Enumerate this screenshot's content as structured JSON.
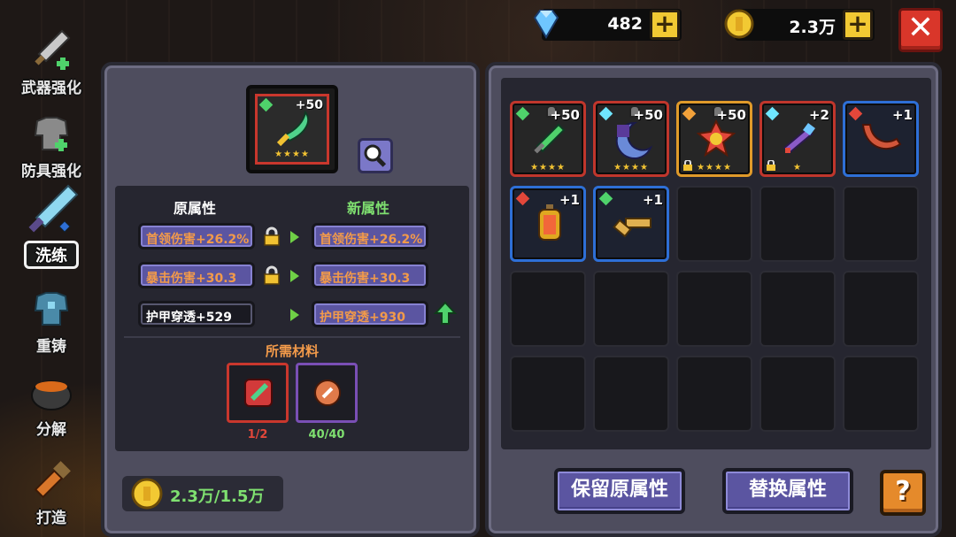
{
  "sidebar": {
    "items": [
      {
        "label": "武器强化",
        "icon": "sword-upgrade-icon"
      },
      {
        "label": "防具强化",
        "icon": "armor-upgrade-icon"
      },
      {
        "label": "洗练",
        "icon": "refine-sword-icon",
        "active": true
      },
      {
        "label": "重铸",
        "icon": "armor-recast-icon"
      },
      {
        "label": "分解",
        "icon": "cauldron-icon"
      },
      {
        "label": "打造",
        "icon": "forge-icon"
      }
    ]
  },
  "currency": {
    "gems": "482",
    "gold": "2.3万",
    "plus_label": "+",
    "close_label": "✕"
  },
  "equipment": {
    "level": "+50",
    "stars": "★★★★"
  },
  "attributes": {
    "old_header": "原属性",
    "new_header": "新属性",
    "rows": [
      {
        "old": "首领伤害+26.2%",
        "new": "首领伤害+26.2%",
        "locked": true
      },
      {
        "old": "暴击伤害+30.3",
        "new": "暴击伤害+30.3",
        "locked": true
      },
      {
        "old": "护甲穿透+529",
        "new": "护甲穿透+930",
        "locked": false,
        "improved": true
      }
    ]
  },
  "materials": {
    "title": "所需材料",
    "items": [
      {
        "count": "1/2",
        "color": "#e2473a"
      },
      {
        "count": "40/40",
        "color": "#7fe070"
      }
    ]
  },
  "gold_cost": "2.3万/1.5万",
  "inventory": [
    {
      "level": "+50",
      "stars": "★★★★",
      "rarity": "red",
      "gem": "#4fd26b",
      "pinned": true,
      "icon": "green-blade-icon"
    },
    {
      "level": "+50",
      "stars": "★★★★",
      "rarity": "red",
      "gem": "#6fe6ff",
      "pinned": true,
      "icon": "crescent-scythe-icon"
    },
    {
      "level": "+50",
      "stars": "★★★★",
      "rarity": "red",
      "gem": "#f2a13a",
      "pinned": true,
      "locked": true,
      "icon": "fire-orb-icon"
    },
    {
      "level": "+2",
      "stars": "★",
      "rarity": "red",
      "gem": "#6fe6ff",
      "locked": true,
      "icon": "crystal-staff-icon"
    },
    {
      "level": "+1",
      "stars": "",
      "rarity": "blue",
      "gem": "#e2473a",
      "icon": "boomerang-icon"
    },
    {
      "level": "+1",
      "stars": "",
      "rarity": "blue",
      "gem": "#e2473a",
      "icon": "lantern-icon"
    },
    {
      "level": "+1",
      "stars": "",
      "rarity": "blue",
      "gem": "#4fd26b",
      "icon": "bone-club-icon"
    }
  ],
  "buttons": {
    "keep": "保留原属性",
    "replace": "替换属性",
    "help": "?"
  }
}
